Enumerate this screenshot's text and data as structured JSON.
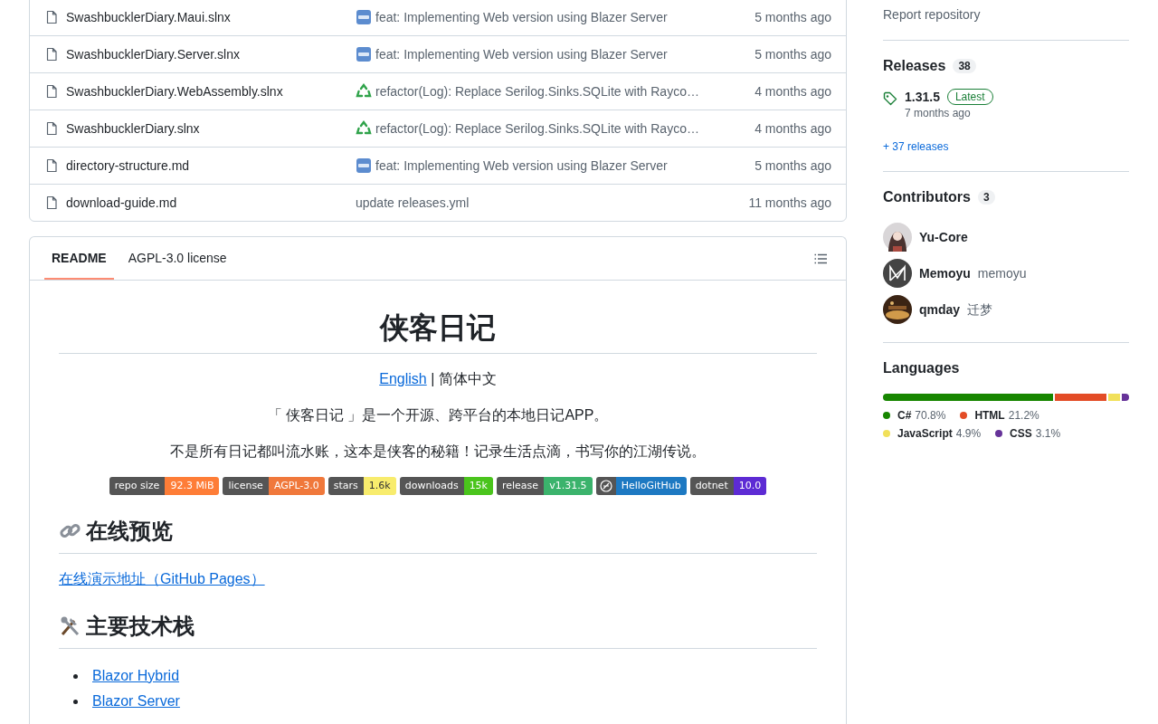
{
  "files": [
    {
      "name": "SwashbucklerDiary.Maui.slnx",
      "kind": "new",
      "commit": "feat: Implementing Web version using Blazer Server",
      "time": "5 months ago"
    },
    {
      "name": "SwashbucklerDiary.Server.slnx",
      "kind": "new",
      "commit": "feat: Implementing Web version using Blazer Server",
      "time": "5 months ago"
    },
    {
      "name": "SwashbucklerDiary.WebAssembly.slnx",
      "kind": "recycle",
      "commit": "refactor(Log): Replace Serilog.Sinks.SQLite with Rayco…",
      "time": "4 months ago"
    },
    {
      "name": "SwashbucklerDiary.slnx",
      "kind": "recycle",
      "commit": "refactor(Log): Replace Serilog.Sinks.SQLite with Rayco…",
      "time": "4 months ago"
    },
    {
      "name": "directory-structure.md",
      "kind": "new",
      "commit": "feat: Implementing Web version using Blazer Server",
      "time": "5 months ago"
    },
    {
      "name": "download-guide.md",
      "kind": "plain",
      "commit": "update releases.yml",
      "time": "11 months ago"
    }
  ],
  "readme": {
    "tabs": [
      {
        "label": "README",
        "selected": true
      },
      {
        "label": "AGPL-3.0 license",
        "selected": false
      }
    ],
    "title": "侠客日记",
    "lang_link": "English",
    "lang_rest": "| 简体中文",
    "intro": "「 侠客日记 」是一个开源、跨平台的本地日记APP。",
    "slogan": "不是所有日记都叫流水账，这本是侠客的秘籍！记录生活点滴，书写你的江湖传说。",
    "badges": [
      {
        "label": "repo size",
        "value": "92.3 MiB",
        "color": "#fe7d37"
      },
      {
        "label": "license",
        "value": "AGPL-3.0",
        "color": "#f0783b"
      },
      {
        "label": "stars",
        "value": "1.6k",
        "color": "#f8ec6d"
      },
      {
        "label": "downloads",
        "value": "15k",
        "color": "#4ac41c"
      },
      {
        "label": "release",
        "value": "v1.31.5",
        "color": "#3bb36c"
      },
      {
        "kind": "logo",
        "value": "HelloGitHub",
        "color": "#1d79c2"
      },
      {
        "label": "dotnet",
        "value": "10.0",
        "color": "#5d2bd4"
      }
    ],
    "sections": [
      {
        "kind": "link",
        "heading": "在线预览",
        "links": [
          "在线演示地址（GitHub Pages）"
        ]
      },
      {
        "kind": "tools",
        "heading": "主要技术栈",
        "bullets": [
          "Blazor Hybrid",
          "Blazor Server"
        ]
      }
    ]
  },
  "sidebar": {
    "report": "Report repository",
    "releases": {
      "title": "Releases",
      "count": "38",
      "version": "1.31.5",
      "badge": "Latest",
      "date": "7 months ago",
      "more": "+ 37 releases"
    },
    "contributors": {
      "title": "Contributors",
      "count": "3",
      "people": [
        {
          "login": "Yu-Core",
          "kind": "girl"
        },
        {
          "login": "Memoyu",
          "name": "memoyu",
          "kind": "m"
        },
        {
          "login": "qmday",
          "name": "迁梦",
          "kind": "photo"
        }
      ]
    },
    "languages": {
      "title": "Languages",
      "items": [
        {
          "name": "C#",
          "percent": "70.8%",
          "color": "#178600"
        },
        {
          "name": "HTML",
          "percent": "21.2%",
          "color": "#e34c26"
        },
        {
          "name": "JavaScript",
          "percent": "4.9%",
          "color": "#f1e05a"
        },
        {
          "name": "CSS",
          "percent": "3.1%",
          "color": "#663399"
        }
      ]
    }
  }
}
